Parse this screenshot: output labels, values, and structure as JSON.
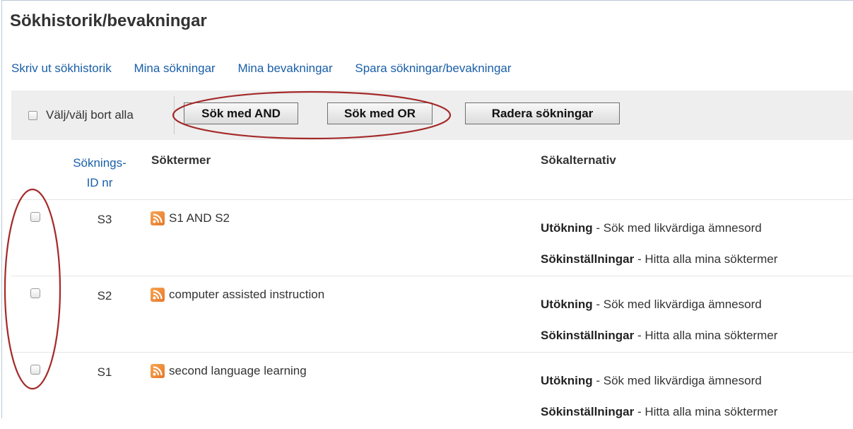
{
  "title": "Sökhistorik/bevakningar",
  "links": [
    "Skriv ut sökhistorik",
    "Mina sökningar",
    "Mina bevakningar",
    "Spara sökningar/bevakningar"
  ],
  "toolbar": {
    "select_all_label": "Välj/välj bort alla",
    "search_and_label": "Sök med AND",
    "search_or_label": "Sök med OR",
    "delete_label": "Radera sökningar"
  },
  "table": {
    "headers": {
      "id_line1": "Söknings-",
      "id_line2": "ID nr",
      "terms": "Söktermer",
      "options": "Sökalternativ"
    },
    "rows": [
      {
        "id": "S3",
        "terms": "S1 AND S2",
        "opt1_label": "Utökning",
        "opt1_value": " - Sök med likvärdiga ämnesord",
        "opt2_label": "Sökinställningar",
        "opt2_value": " - Hitta alla mina söktermer"
      },
      {
        "id": "S2",
        "terms": "computer assisted instruction",
        "opt1_label": "Utökning",
        "opt1_value": " - Sök med likvärdiga ämnesord",
        "opt2_label": "Sökinställningar",
        "opt2_value": " - Hitta alla mina söktermer"
      },
      {
        "id": "S1",
        "terms": "second language learning",
        "opt1_label": "Utökning",
        "opt1_value": " - Sök med likvärdiga ämnesord",
        "opt2_label": "Sökinställningar",
        "opt2_value": " - Hitta alla mina söktermer"
      }
    ]
  },
  "icons": {
    "feed": "rss-feed-icon"
  },
  "colors": {
    "link": "#1a5fa8",
    "toolbar_bg": "#eeeeee",
    "annotation": "#a52a2a",
    "rss": "#f29a3e"
  }
}
